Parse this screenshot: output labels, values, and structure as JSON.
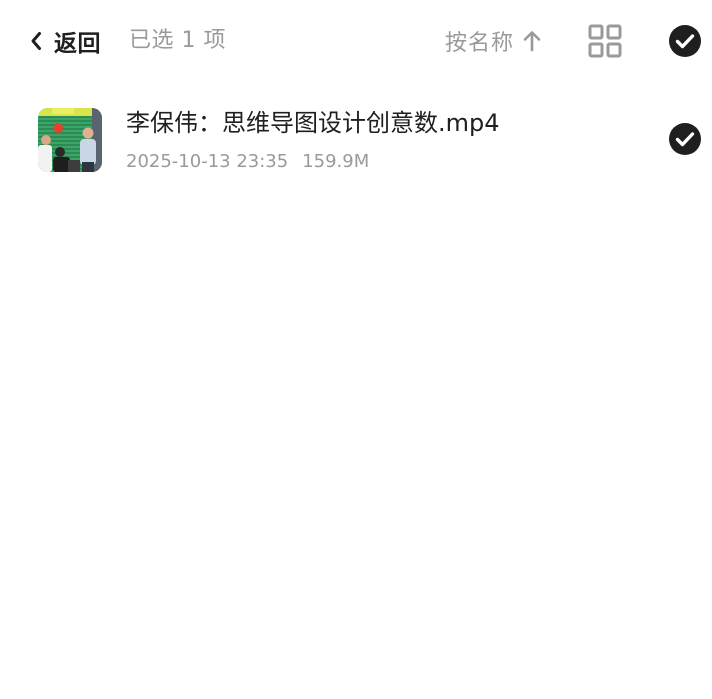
{
  "header": {
    "back_label": "返回",
    "selected_text": "已选 1 项",
    "sort_label": "按名称"
  },
  "files": [
    {
      "name": "李保伟：思维导图设计创意数.mp4",
      "date": "2025-10-13 23:35",
      "size": "159.9M",
      "selected": true
    }
  ],
  "icons": {
    "back": "chevron-left-icon",
    "sort": "arrow-up-icon",
    "view": "grid-view-icon",
    "check": "check-circle-icon"
  },
  "colors": {
    "primary_text": "#1f1f1f",
    "secondary_text": "#9a9a9a",
    "check_fill": "#1f1f1f"
  }
}
